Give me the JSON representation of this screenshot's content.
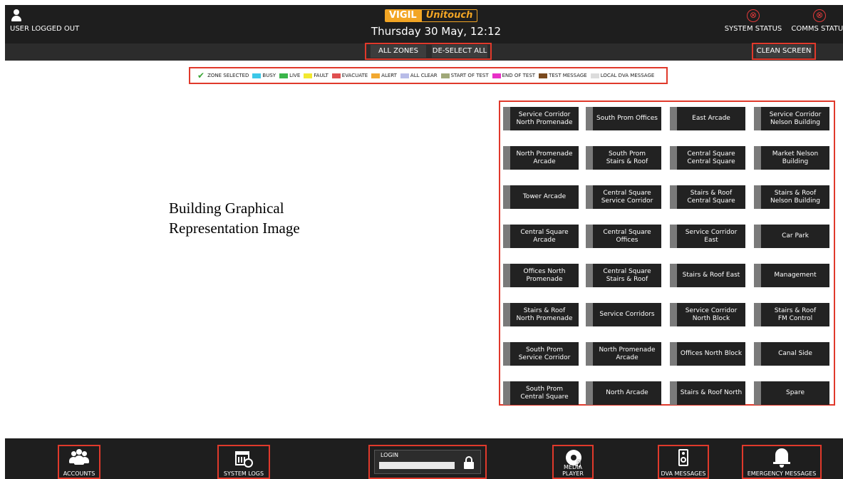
{
  "header": {
    "user_status": "USER LOGGED OUT",
    "logo_vigil": "VIGIL",
    "logo_unitouch": "Unitouch",
    "datetime": "Thursday 30 May, 12:12",
    "system_status": "SYSTEM STATUS",
    "comms_status": "COMMS STATUS",
    "status_glyph": "⊗",
    "status_color": "#e23a3a",
    "all_zones": "ALL ZONES",
    "deselect_all": "DE-SELECT ALL",
    "clean_screen": "CLEAN SCREEN"
  },
  "legend": {
    "zone_selected": "ZONE SELECTED",
    "items": [
      {
        "label": "BUSY",
        "color": "#3cc8e8"
      },
      {
        "label": "LIVE",
        "color": "#3ab54a"
      },
      {
        "label": "FAULT",
        "color": "#f2e830"
      },
      {
        "label": "EVACUATE",
        "color": "#e05050"
      },
      {
        "label": "ALERT",
        "color": "#f2a830"
      },
      {
        "label": "ALL CLEAR",
        "color": "#b8bce8"
      },
      {
        "label": "START OF TEST",
        "color": "#a0a878"
      },
      {
        "label": "END OF TEST",
        "color": "#e830c8"
      },
      {
        "label": "TEST MESSAGE",
        "color": "#7a4a1e"
      },
      {
        "label": "LOCAL DVA MESSAGE",
        "color": "#dcdcdc"
      }
    ]
  },
  "placeholder": {
    "line1": "Building Graphical",
    "line2": "Representation Image"
  },
  "zones": [
    "Service Corridor\nNorth Promenade",
    "South Prom Offices",
    "East Arcade",
    "Service Corridor\nNelson Building",
    "North Promenade\nArcade",
    "South Prom\nStairs & Roof",
    "Central Square\nCentral Square",
    "Market Nelson\nBuilding",
    "Tower Arcade",
    "Central Square\nService Corridor",
    "Stairs & Roof\nCentral Square",
    "Stairs & Roof\nNelson Building",
    "Central Square\nArcade",
    "Central Square\nOffices",
    "Service Corridor\nEast",
    "Car Park",
    "Offices North\nPromenade",
    "Central Square\nStairs & Roof",
    "Stairs & Roof East",
    "Management",
    "Stairs & Roof\nNorth Promenade",
    "Service Corridors",
    "Service Corridor\nNorth Block",
    "Stairs & Roof\nFM Control",
    "South Prom\nService Corridor",
    "North Promenade\nArcade",
    "Offices North Block",
    "Canal Side",
    "South Prom\nCentral Square",
    "North Arcade",
    "Stairs & Roof North",
    "Spare"
  ],
  "footer": {
    "accounts": "ACCOUNTS",
    "system_logs": "SYSTEM LOGS",
    "login_label": "LOGIN",
    "media_player": "MEDIA PLAYER",
    "dva_messages": "DVA MESSAGES",
    "emergency_messages": "EMERGENCY MESSAGES"
  }
}
